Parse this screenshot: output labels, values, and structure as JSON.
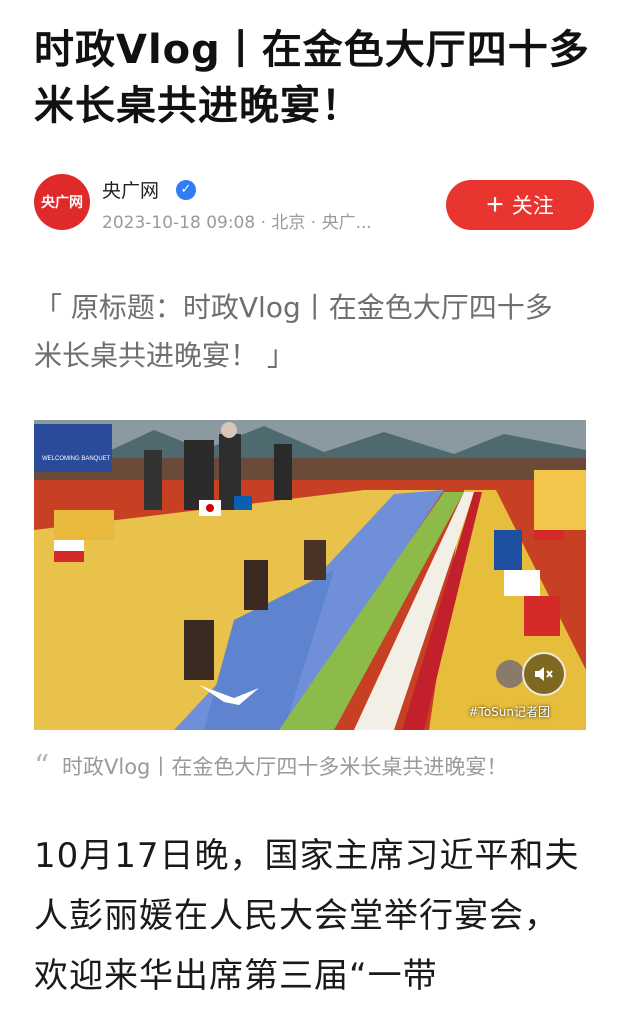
{
  "article": {
    "title": "时政Vlog丨在金色大厅四十多米长桌共进晚宴！",
    "author": {
      "avatar_text": "央广网",
      "name": "央广网",
      "meta": "2023-10-18 09:08 · 北京 · 央广..."
    },
    "follow_label": "关注",
    "original_title": "「 原标题：时政Vlog丨在金色大厅四十多米长桌共进晚宴！ 」",
    "image": {
      "banner_text": "WELCOMING BANQUET",
      "watermark": "#ToSun记者团"
    },
    "caption": "时政Vlog丨在金色大厅四十多米长桌共进晚宴！",
    "body": "10月17日晚，国家主席习近平和夫人彭丽媛在人民大会堂举行宴会，欢迎来华出席第三届“一带"
  },
  "colors": {
    "accent": "#e8352f",
    "verified": "#2f7cf6",
    "avatar": "#e02a2a"
  },
  "icons": {
    "verified": "check-badge-icon",
    "quote": "quote-icon",
    "audio": "speaker-mute-icon",
    "plus": "plus-icon"
  }
}
